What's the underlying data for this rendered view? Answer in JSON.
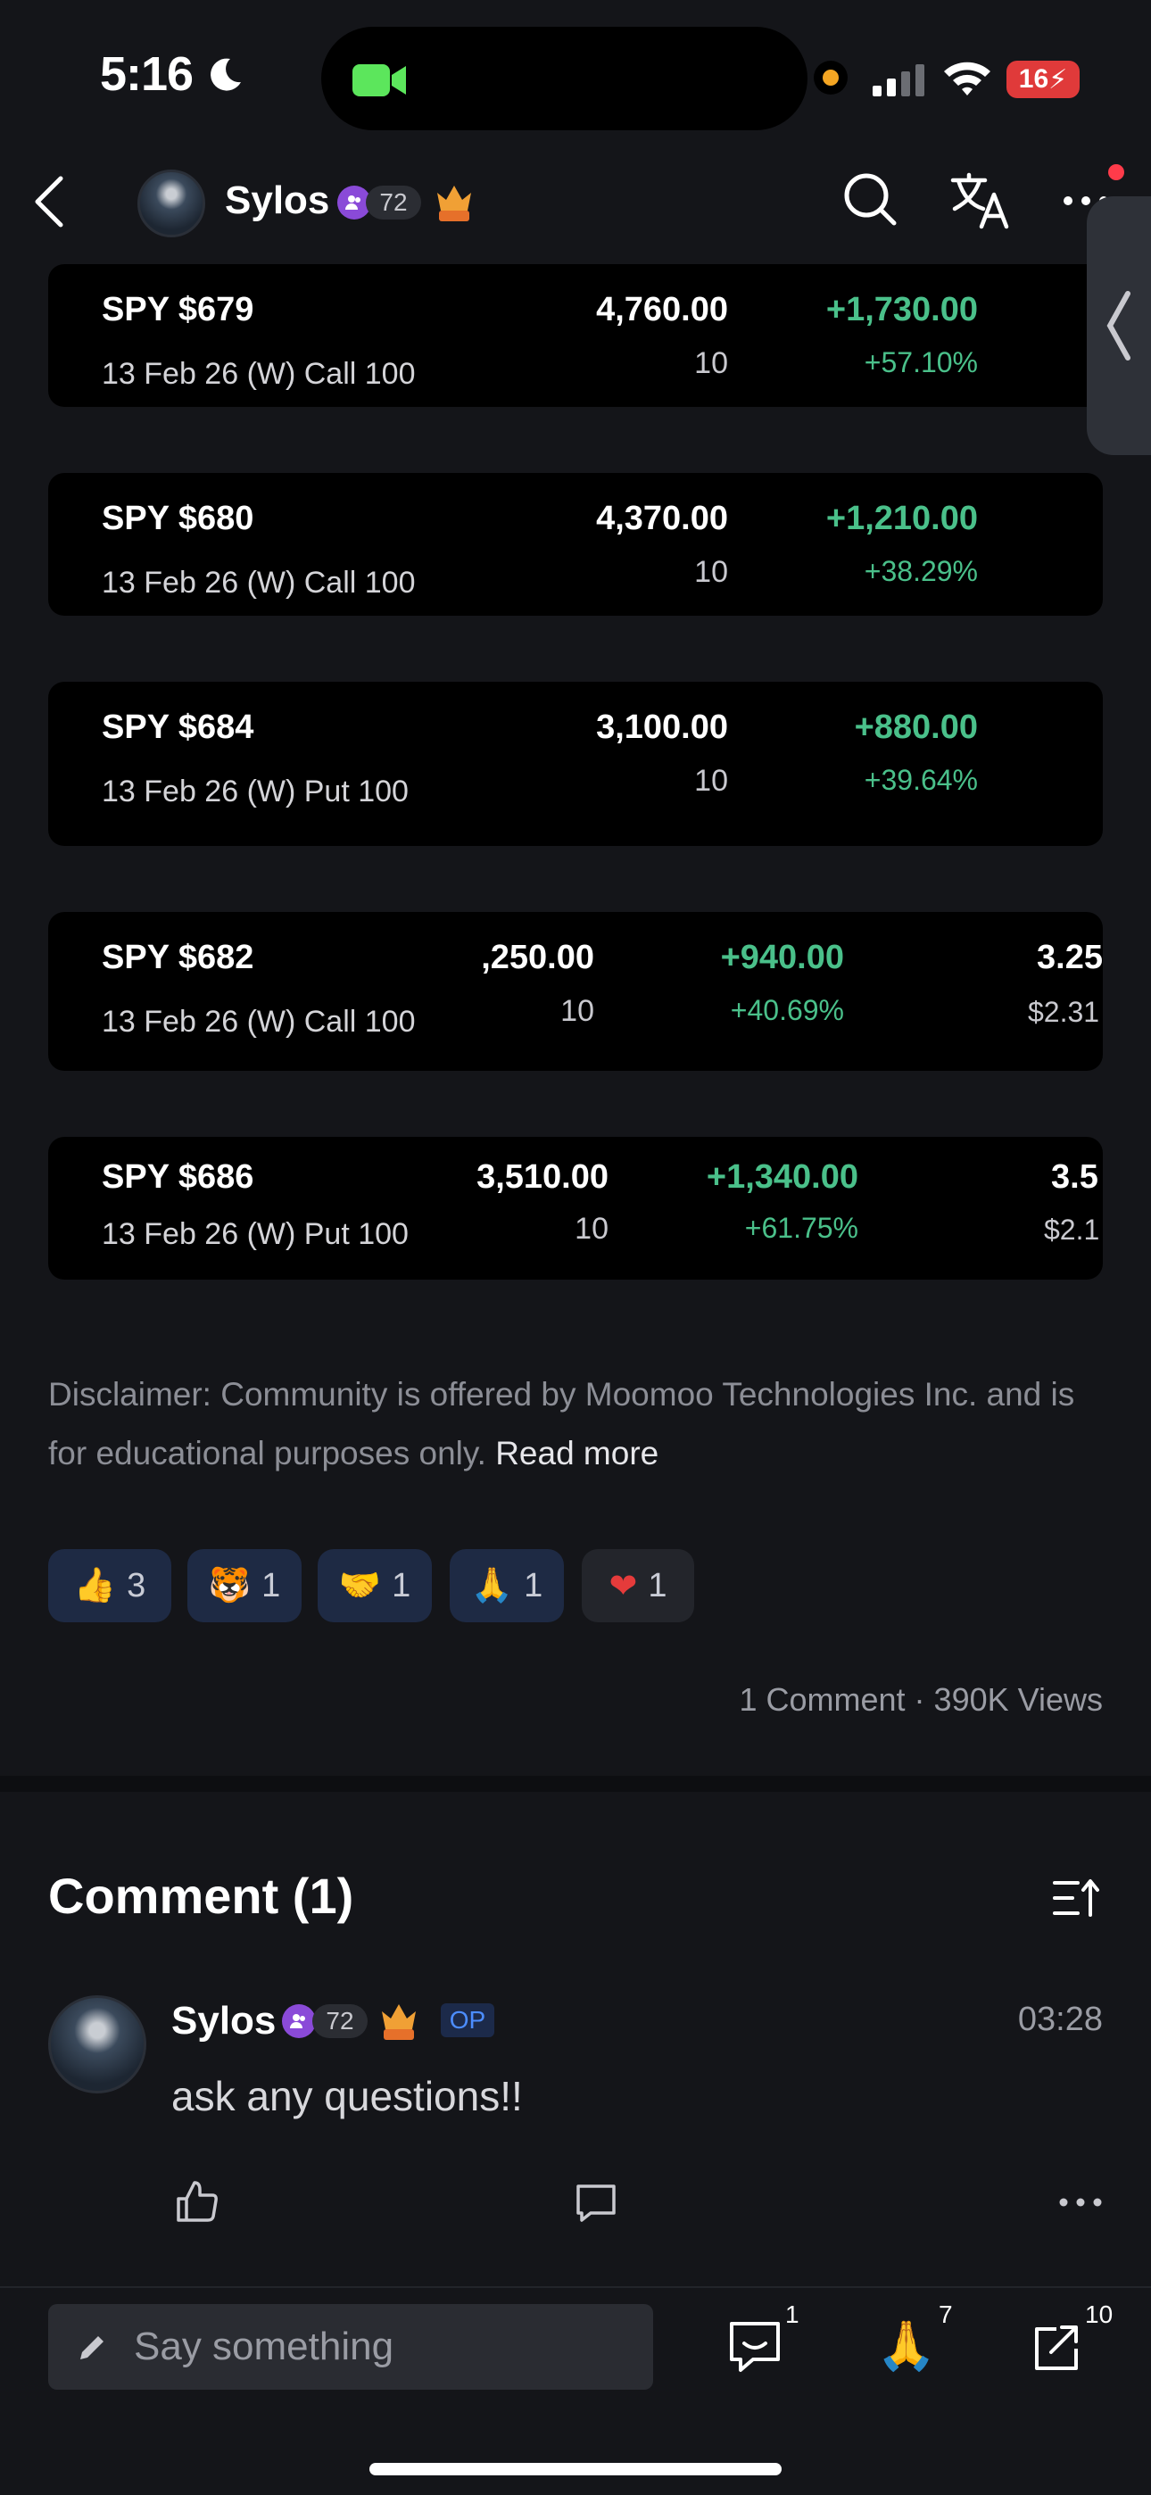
{
  "status_bar": {
    "time": "5:16",
    "battery": "16"
  },
  "header": {
    "username": "Sylos",
    "level": "72"
  },
  "positions": [
    {
      "symbol": "SPY $679",
      "description": "13 Feb 26 (W) Call 100",
      "value": "4,760.00",
      "qty": "10",
      "pl": "+1,730.00",
      "pl_pct": "+57.10%"
    },
    {
      "symbol": "SPY $680",
      "description": "13 Feb 26 (W) Call 100",
      "value": "4,370.00",
      "qty": "10",
      "pl": "+1,210.00",
      "pl_pct": "+38.29%"
    },
    {
      "symbol": "SPY $684",
      "description": "13 Feb 26 (W) Put 100",
      "value": "3,100.00",
      "qty": "10",
      "pl": "+880.00",
      "pl_pct": "+39.64%"
    },
    {
      "symbol": "SPY $682",
      "description": "13 Feb 26 (W) Call 100",
      "value": ",250.00",
      "qty": "10",
      "pl": "+940.00",
      "pl_pct": "+40.69%",
      "extra_top": "3.25",
      "extra_bottom": "$2.31"
    },
    {
      "symbol": "SPY $686",
      "description": "13 Feb 26 (W) Put 100",
      "value": "3,510.00",
      "qty": "10",
      "pl": "+1,340.00",
      "pl_pct": "+61.75%",
      "extra_top": "3.5",
      "extra_bottom": "$2.1"
    }
  ],
  "disclaimer": {
    "text": "Disclaimer: Community is offered by Moomoo Technologies Inc. and is for educational purposes only.",
    "link": "Read more"
  },
  "reactions": [
    {
      "icon": "thumbs-up-icon",
      "count": "3"
    },
    {
      "icon": "tiger-icon",
      "count": "1"
    },
    {
      "icon": "handshake-icon",
      "count": "1"
    },
    {
      "icon": "pray-icon",
      "count": "1"
    },
    {
      "icon": "heart-icon",
      "count": "1"
    }
  ],
  "post_stats": "1 Comment · 390K Views",
  "comments_section": {
    "title": "Comment (1)",
    "comments": [
      {
        "author": "Sylos",
        "level": "72",
        "op_tag": "OP",
        "time": "03:28",
        "text": "ask any questions!!"
      }
    ]
  },
  "bottom_bar": {
    "placeholder": "Say something",
    "comment_count": "1",
    "pray_count": "7",
    "share_count": "10"
  },
  "colors": {
    "background": "#141519",
    "card": "#000000",
    "gain_green": "#4ac08a",
    "accent_blue": "#4c8dff",
    "level_purple": "#8a4ad8"
  }
}
